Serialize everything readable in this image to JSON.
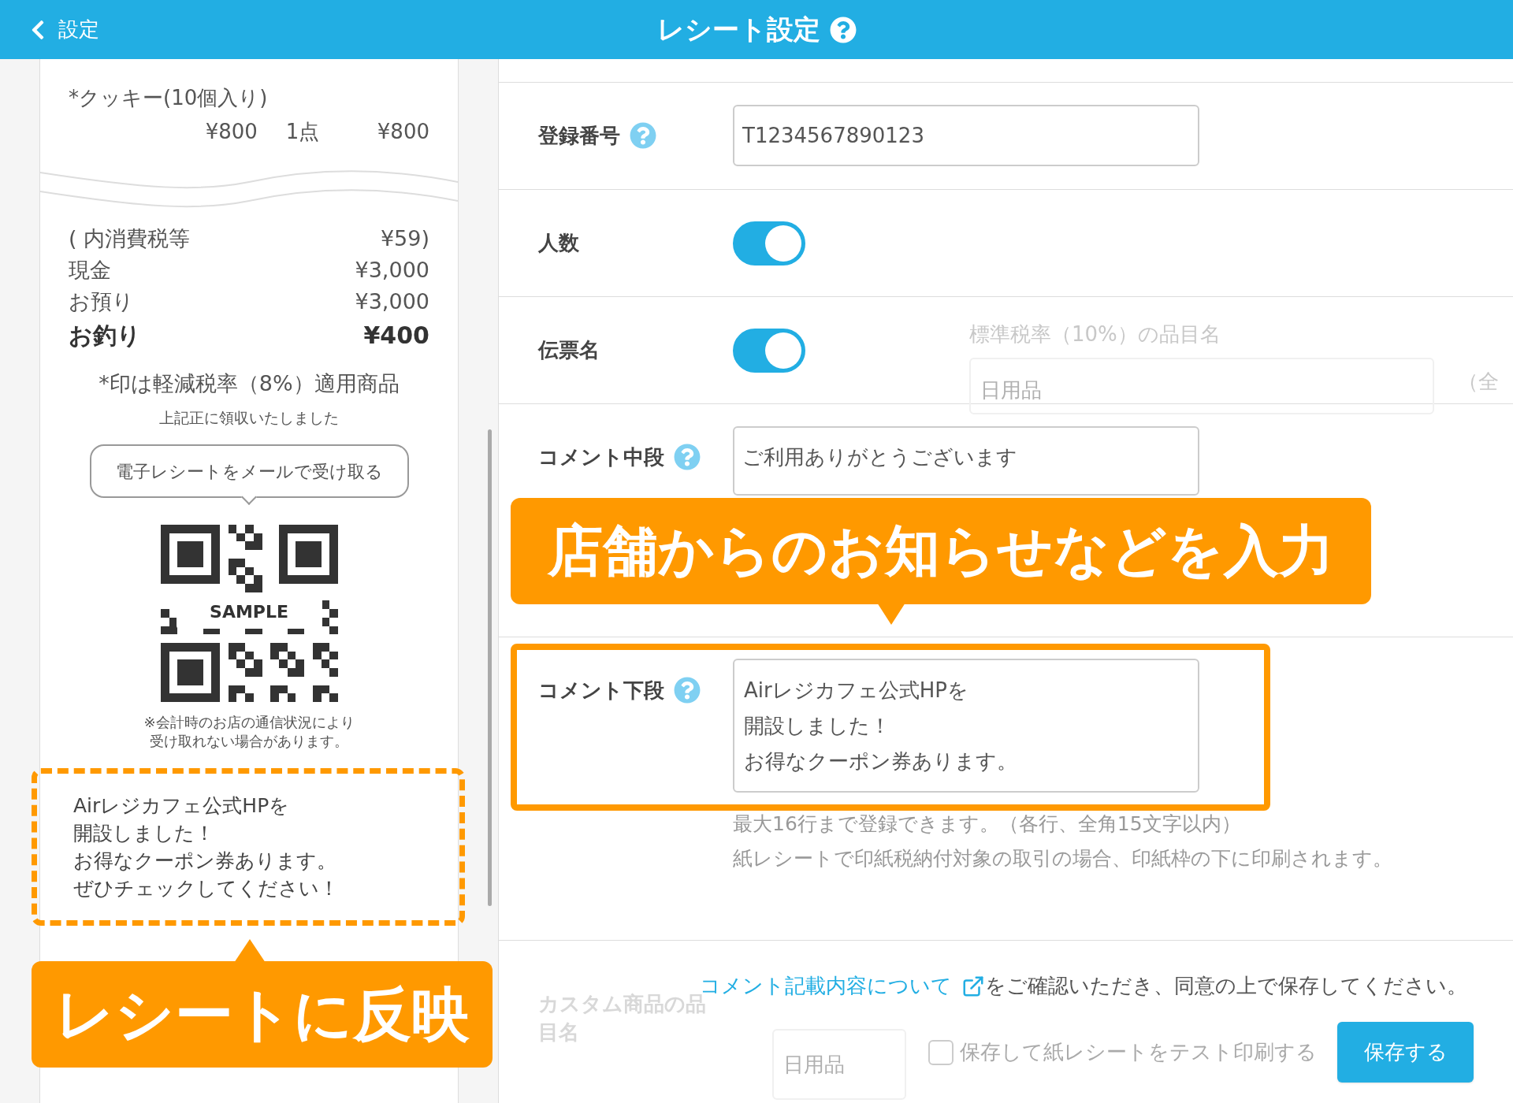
{
  "header": {
    "back_label": "設定",
    "title": "レシート設定"
  },
  "receipt": {
    "items": [
      {
        "name": "*クッキー(10個入り)",
        "price": "¥800",
        "qty": "1点",
        "total": "¥800"
      }
    ],
    "totals": [
      {
        "label": "(  内消費税等",
        "value": "¥59)",
        "bold": false
      },
      {
        "label": "現金",
        "value": "¥3,000",
        "bold": false
      },
      {
        "label": "お預り",
        "value": "¥3,000",
        "bold": false
      },
      {
        "label": "お釣り",
        "value": "¥400",
        "bold": true
      }
    ],
    "reduced_note": "*印は軽減税率（8%）適用商品",
    "received_note": "上記正に領収いたしました",
    "email_button": "電子レシートをメールで受け取る",
    "qr_label": "SAMPLE",
    "network_note": [
      "※会計時のお店の通信状況により",
      "受け取れない場合があります。"
    ],
    "comment": [
      "Airレジカフェ公式HPを",
      "開設しました！",
      "お得なクーポン券あります。",
      "ぜひチェックしてください！"
    ],
    "comment_highlighted": true
  },
  "settings": [
    {
      "kind": "input",
      "label": "登録番号",
      "help": true,
      "value": "T1234567890123"
    },
    {
      "kind": "toggle",
      "label": "人数",
      "help": false,
      "on": true
    },
    {
      "kind": "toggle",
      "label": "伝票名",
      "help": false,
      "on": true
    },
    {
      "kind": "input",
      "label": "コメント中段",
      "help": true,
      "value": "ご利用ありがとうございます"
    },
    {
      "kind": "textarea",
      "label": "コメント下段",
      "help": true,
      "value": [
        "Airレジカフェ公式HPを",
        "開設しました！",
        "お得なクーポン券あります。"
      ],
      "hints": [
        "最大16行まで登録できます。（各行、全角15文字以内）",
        "紙レシートで印紙税納付対象の取引の場合、印紙枠の下に印刷されます。"
      ],
      "highlighted": true
    }
  ],
  "ghost_upper": {
    "heading": "標準税率（10%）の品目名",
    "placeholder": "日用品",
    "suffix": "（全"
  },
  "ghost_lower": {
    "label": [
      "カスタム商品の品",
      "目名"
    ],
    "placeholder": "日用品"
  },
  "footer": {
    "link": "コメント記載内容について",
    "notice": "をご確認いただき、同意の上で保存してください。",
    "test_print": {
      "label": "保存して紙レシートをテスト印刷する",
      "checked": false
    },
    "save_button": "保存する"
  },
  "callouts": [
    {
      "kind": "receipt",
      "text": "レシートに反映"
    },
    {
      "kind": "form",
      "text": "店舗からのお知らせなどを入力"
    }
  ]
}
